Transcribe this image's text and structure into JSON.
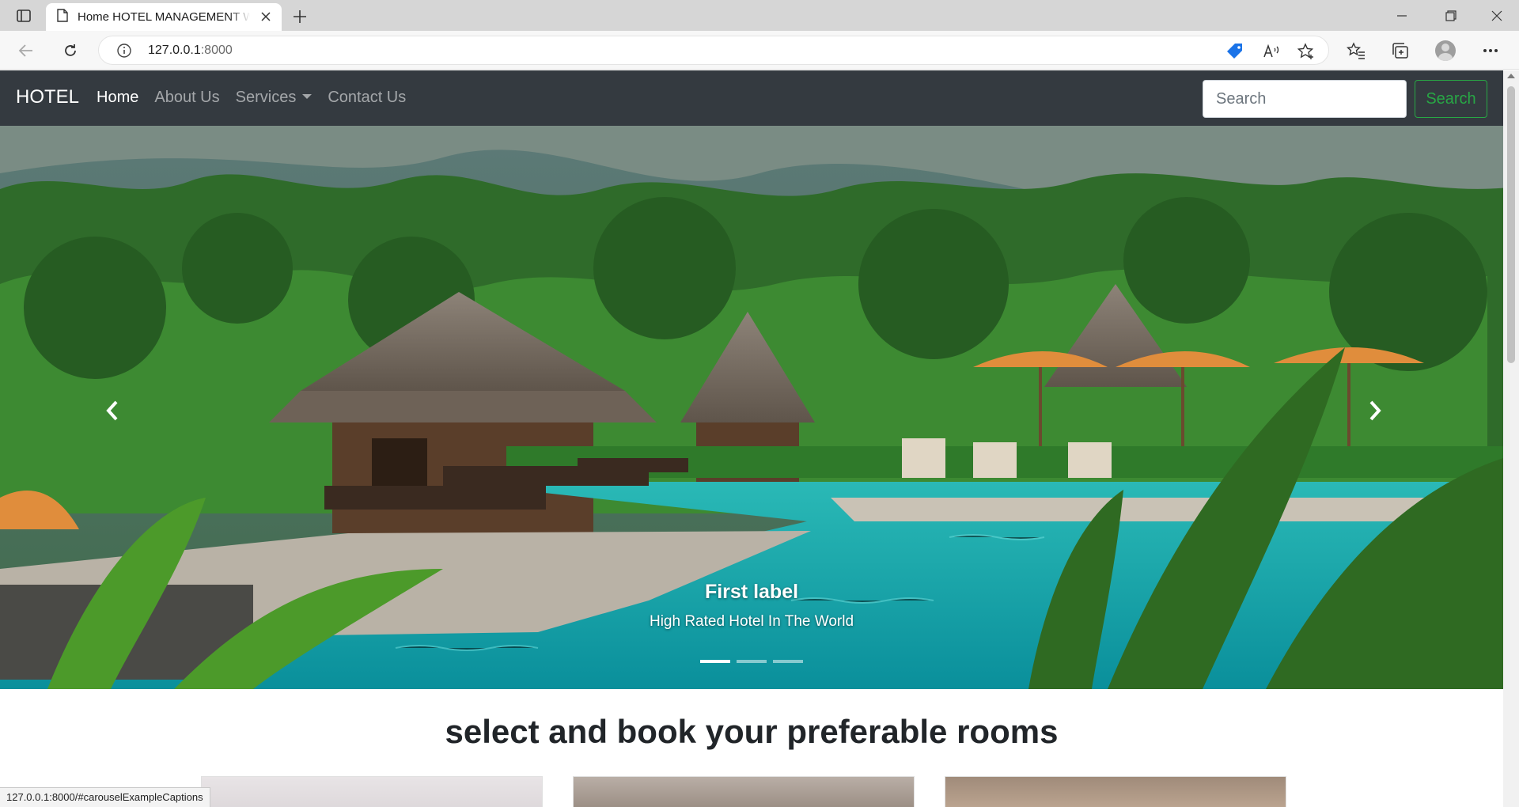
{
  "browser": {
    "tab_title": "Home HOTEL MANAGEMENT WEBSITE",
    "url_host": "127.0.0.1",
    "url_port": ":8000",
    "status_url": "127.0.0.1:8000/#carouselExampleCaptions"
  },
  "navbar": {
    "brand": "HOTEL",
    "links": [
      {
        "label": "Home",
        "active": true
      },
      {
        "label": "About Us",
        "active": false
      },
      {
        "label": "Services",
        "active": false
      },
      {
        "label": "Contact Us",
        "active": false
      }
    ],
    "search_placeholder": "Search",
    "search_button": "Search"
  },
  "carousel": {
    "caption_title": "First label",
    "caption_text": "High Rated Hotel In The World",
    "slide_count": 3,
    "active_slide": 1
  },
  "rooms": {
    "heading": "select and book your preferable rooms"
  },
  "colors": {
    "navbar_bg": "#343a40",
    "success": "#28a745"
  }
}
